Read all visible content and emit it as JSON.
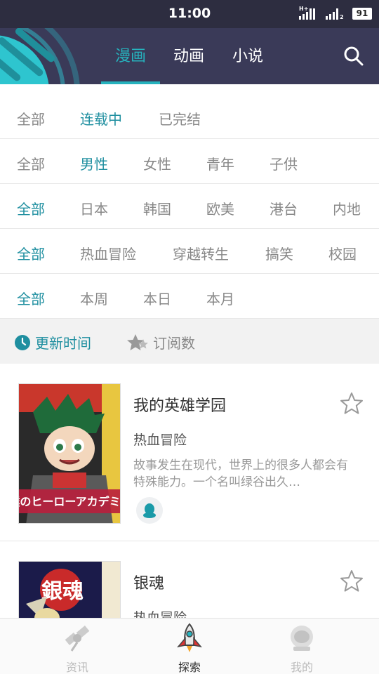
{
  "status_bar": {
    "time": "11:00",
    "network_1": "H+",
    "network_2": "2",
    "battery": "91"
  },
  "header": {
    "tabs": [
      {
        "label": "漫画",
        "active": true
      },
      {
        "label": "动画",
        "active": false
      },
      {
        "label": "小说",
        "active": false
      }
    ],
    "accent_color": "#26b2bd"
  },
  "filters": {
    "status": [
      "全部",
      "连载中",
      "已完结"
    ],
    "audience": [
      "全部",
      "男性",
      "女性",
      "青年",
      "子供"
    ],
    "region": [
      "全部",
      "日本",
      "韩国",
      "欧美",
      "港台",
      "内地"
    ],
    "genre": [
      "全部",
      "热血冒险",
      "穿越转生",
      "搞笑",
      "校园"
    ],
    "period": [
      "全部",
      "本周",
      "本日",
      "本月"
    ]
  },
  "sort": {
    "update_time": "更新时间",
    "subscriptions": "订阅数"
  },
  "comics": [
    {
      "title": "我的英雄学园",
      "genre": "热血冒险",
      "description": "故事发生在现代，世界上的很多人都会有特殊能力。一个名叫绿谷出久…",
      "cover_text": "僕のヒーローアカデミア"
    },
    {
      "title": "银魂",
      "genre": "热血冒险",
      "cover_text": "銀魂"
    }
  ],
  "bottom_nav": [
    {
      "label": "资讯",
      "icon": "satellite-icon",
      "active": false
    },
    {
      "label": "探索",
      "icon": "rocket-icon",
      "active": true
    },
    {
      "label": "我的",
      "icon": "astronaut-helmet-icon",
      "active": false
    }
  ]
}
